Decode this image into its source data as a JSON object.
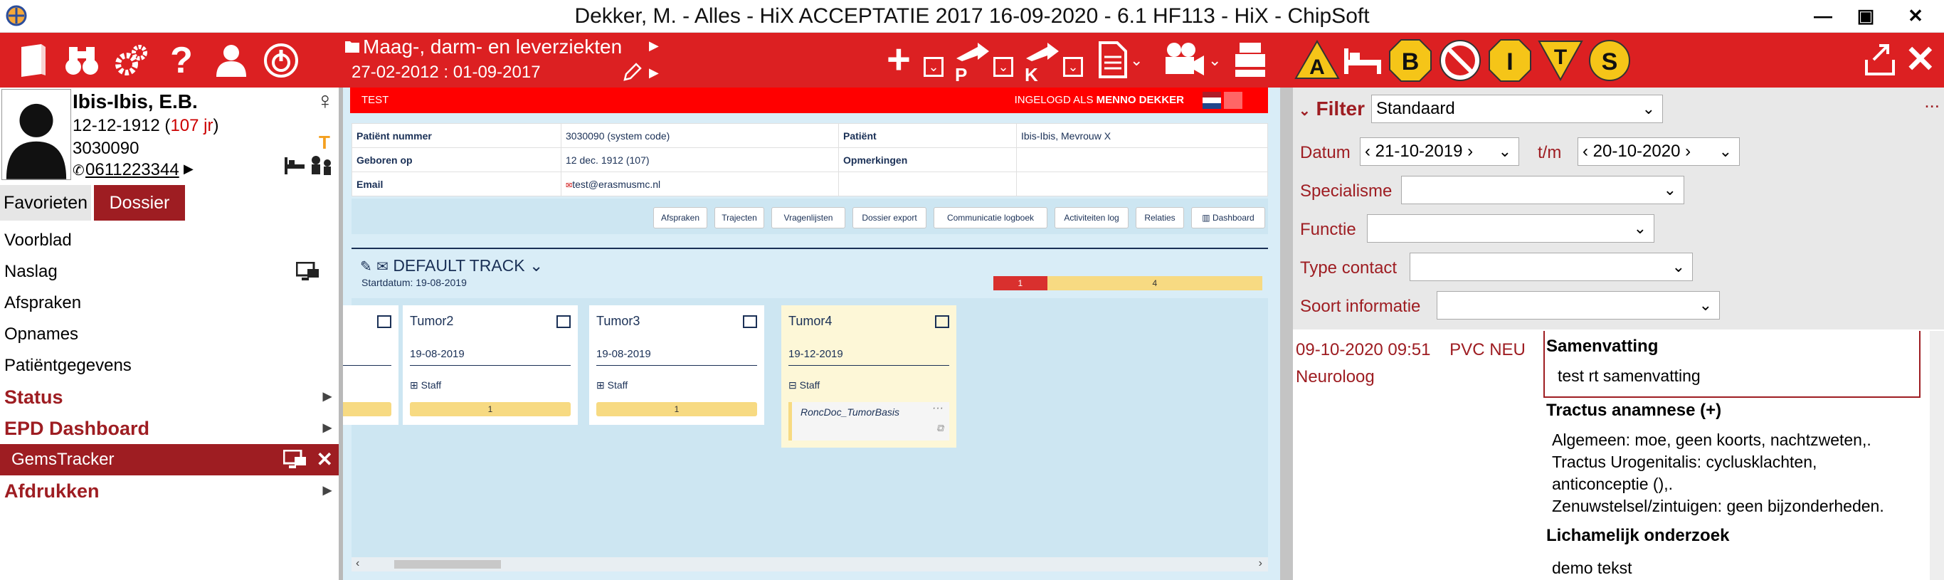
{
  "window": {
    "title": "Dekker, M. - Alles - HiX ACCEPTATIE 2017 16-09-2020 - 6.1 HF113 - HiX - ChipSoft",
    "minimize": "—",
    "maximize": "▣",
    "close": "✕"
  },
  "toolbar_left": {
    "icons": [
      "book-icon",
      "binoculars-icon",
      "gears-icon",
      "help-icon",
      "user-icon",
      "power-icon"
    ]
  },
  "header": {
    "department": "Maag-, darm- en leverziekten",
    "period": "27-02-2012 : 01-09-2017"
  },
  "toolbar_right": {
    "badges": [
      "A",
      "B",
      "I",
      "T",
      "S"
    ]
  },
  "patient": {
    "name": "Ibis-Ibis, E.B.",
    "dob": "12-12-1912",
    "age": "107 jr",
    "number": "3030090",
    "phone": "0611223344",
    "gender_symbol": "♀",
    "flag": "T"
  },
  "tabs": {
    "favorites": "Favorieten",
    "dossier": "Dossier"
  },
  "nav": {
    "items": [
      {
        "label": "Voorblad"
      },
      {
        "label": "Naslag"
      },
      {
        "label": "Afspraken"
      },
      {
        "label": "Opnames"
      },
      {
        "label": "Patiëntgegevens"
      },
      {
        "label": "Status"
      },
      {
        "label": "EPD Dashboard"
      },
      {
        "label": "GemsTracker"
      },
      {
        "label": "Afdrukken"
      }
    ]
  },
  "content": {
    "banner_left": "TEST",
    "banner_logged": "INGELOGD ALS",
    "banner_user": "MENNO DEKKER",
    "table": {
      "patient_number_label": "Patiënt nummer",
      "patient_number_value": "3030090 (system code)",
      "patient_label": "Patiënt",
      "patient_value": "Ibis-Ibis, Mevrouw X",
      "born_label": "Geboren op",
      "born_value": "12 dec. 1912 (107)",
      "remarks_label": "Opmerkingen",
      "remarks_value": "",
      "email_label": "Email",
      "email_value": "test@erasmusmc.nl"
    },
    "actions": [
      "Afspraken",
      "Trajecten",
      "Vragenlijsten",
      "Dossier export",
      "Communicatie logboek",
      "Activiteiten log",
      "Relaties",
      "Dashboard"
    ],
    "track": {
      "title": "DEFAULT TRACK",
      "start": "Startdatum: 19-08-2019",
      "progress_done": "1",
      "progress_todo": "4",
      "progress_done_fraction": 0.2
    },
    "cards": [
      {
        "name": "",
        "date": "",
        "staff": "",
        "count": ""
      },
      {
        "name": "Tumor2",
        "date": "19-08-2019",
        "staff": "Staff",
        "count": "1"
      },
      {
        "name": "Tumor3",
        "date": "19-08-2019",
        "staff": "Staff",
        "count": "1"
      },
      {
        "name": "Tumor4",
        "date": "19-12-2019",
        "staff": "Staff",
        "doc": "RoncDoc_TumorBasis"
      }
    ]
  },
  "filter": {
    "label": "Filter",
    "preset": "Standaard",
    "more": "...",
    "date_label": "Datum",
    "date_from": "21-10-2019",
    "date_to_label": "t/m",
    "date_to": "20-10-2020",
    "specialism_label": "Specialisme",
    "function_label": "Functie",
    "contact_label": "Type contact",
    "info_label": "Soort informatie"
  },
  "result": {
    "datetime": "09-10-2020 09:51",
    "code": "PVC NEU",
    "role": "Neuroloog",
    "summary_head": "Samenvatting",
    "summary_text": "test rt samenvatting",
    "tract_head": "Tractus anamnese (+)",
    "tract_line1": "Algemeen: moe, geen koorts, nachtzweten,.",
    "tract_line2": "Tractus Urogenitalis: cyclusklachten,",
    "tract_line3": "anticonceptie (),.",
    "tract_line4": "Zenuwstelsel/zintuigen: geen bijzonderheden.",
    "exam_head": "Lichamelijk onderzoek",
    "exam_text": "demo tekst"
  },
  "colors": {
    "brand_red": "#dc2022",
    "dark_red": "#9e1d22",
    "light_blue": "#d9edf7",
    "track_yellow": "#f7da82"
  }
}
